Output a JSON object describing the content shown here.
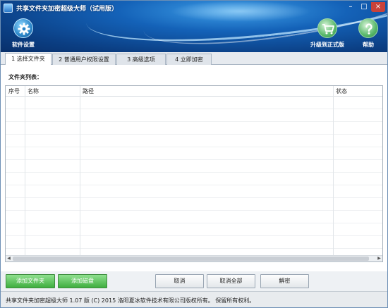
{
  "window": {
    "title": "共享文件夹加密超级大师（试用版）",
    "controls": {
      "minimize": "–",
      "maximize": "□",
      "close": "×"
    }
  },
  "toolbar": {
    "settings_label": "软件设置",
    "settings_icon": "gear-icon",
    "upgrade_label": "升级到正式版",
    "upgrade_icon": "cart-icon",
    "help_label": "帮助",
    "help_icon": "question-icon"
  },
  "tabs": [
    {
      "label": "1 选择文件夹",
      "active": true
    },
    {
      "label": "2 普通用户权限设置",
      "active": false
    },
    {
      "label": "3 高级选项",
      "active": false
    },
    {
      "label": "4 立即加密",
      "active": false
    }
  ],
  "main": {
    "list_label": "文件夹列表：",
    "columns": [
      "序号",
      "名称",
      "路径",
      "状态"
    ],
    "rows": []
  },
  "buttons": {
    "add_folder": "添加文件夹",
    "add_disk": "添加磁盘",
    "cancel": "取消",
    "cancel_all": "取消全部",
    "decrypt": "解密"
  },
  "status": {
    "text": "共享文件夹加密超级大师 1.07 版  (C) 2015 洛阳夏冰软件技术有限公司版权所有。 保留所有权利。"
  },
  "colors": {
    "header_blue": "#1462b8",
    "accent_green": "#3fae3f",
    "close_red": "#c9423a"
  }
}
